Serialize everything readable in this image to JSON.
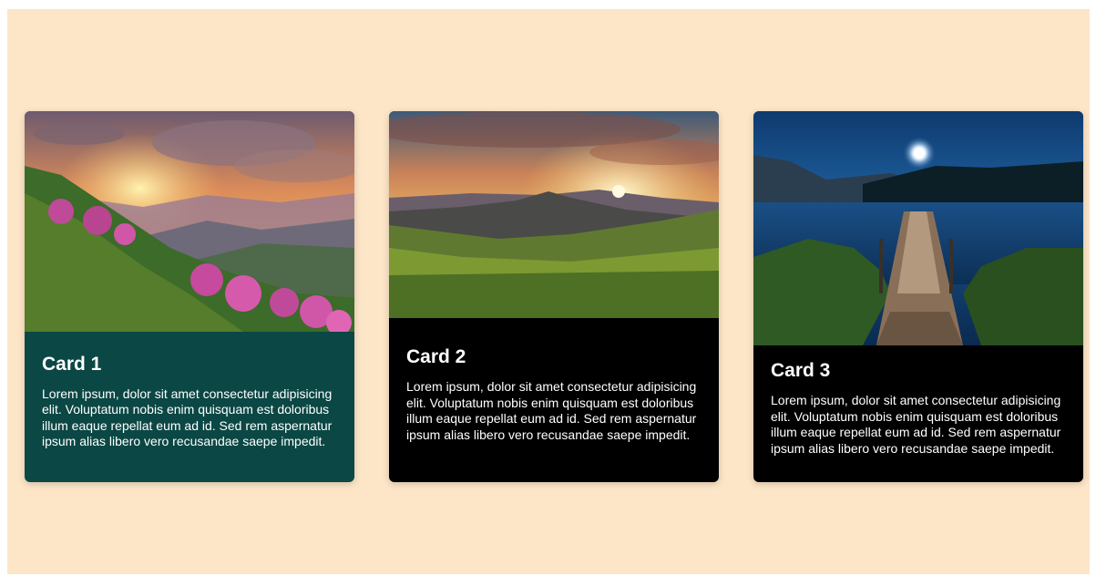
{
  "page": {
    "background_color": "#fde5c7"
  },
  "cards": [
    {
      "title": "Card 1",
      "text": "Lorem ipsum, dolor sit amet consectetur adipisicing elit. Voluptatum nobis enim quisquam est doloribus illum eaque repellat eum ad id. Sed rem aspernatur ipsum alias libero vero recusandae saepe impedit.",
      "body_color": "#0b4744",
      "image_icon": "mountain-sunset-flowers-image"
    },
    {
      "title": "Card 2",
      "text": "Lorem ipsum, dolor sit amet consectetur adipisicing elit. Voluptatum nobis enim quisquam est doloribus illum eaque repellat eum ad id. Sed rem aspernatur ipsum alias libero vero recusandae saepe impedit.",
      "body_color": "#000000",
      "image_icon": "mountain-sunrise-meadow-image"
    },
    {
      "title": "Card 3",
      "text": "Lorem ipsum, dolor sit amet consectetur adipisicing elit. Voluptatum nobis enim quisquam est doloribus illum eaque repellat eum ad id. Sed rem aspernatur ipsum alias libero vero recusandae saepe impedit.",
      "body_color": "#000000",
      "image_icon": "lake-pier-moonlight-image"
    }
  ]
}
